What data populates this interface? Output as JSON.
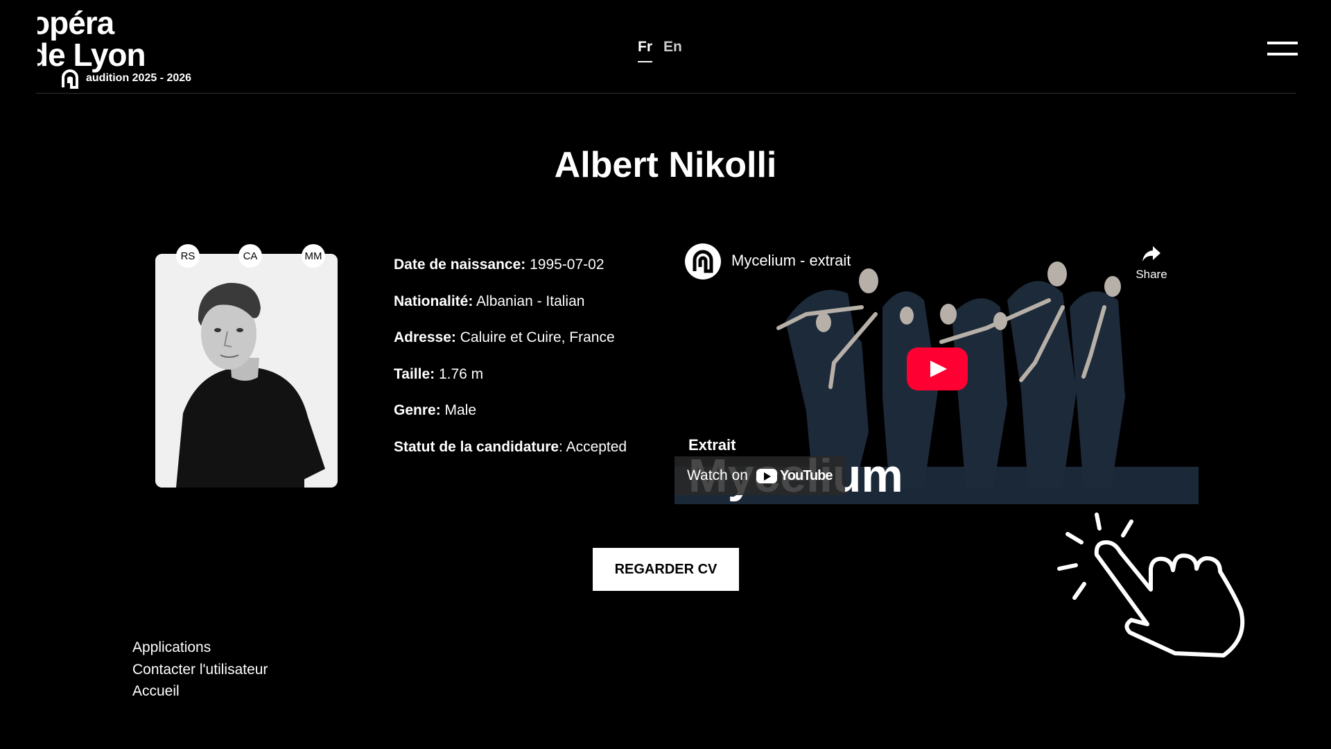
{
  "header": {
    "logo": {
      "line1": "opéra",
      "line2": "de Lyon",
      "subtitle": "audition 2025 - 2026"
    },
    "languages": [
      {
        "label": "Fr",
        "active": true
      },
      {
        "label": "En",
        "active": false
      }
    ],
    "menu_icon": "hamburger-icon"
  },
  "profile": {
    "name": "Albert Nikolli",
    "badges": [
      "RS",
      "CA",
      "MM"
    ],
    "details": [
      {
        "label": "Date de naissance:",
        "value": " 1995-07-02"
      },
      {
        "label": "Nationalité:",
        "value": " Albanian - Italian"
      },
      {
        "label": "Adresse:",
        "value": " Caluire et Cuire, France"
      },
      {
        "label": "Taille:",
        "value": " 1.76 m"
      },
      {
        "label": "Genre:",
        "value": " Male"
      },
      {
        "label": "Statut de la candidature",
        "value": ": Accepted"
      }
    ]
  },
  "video": {
    "title": "Mycelium - extrait",
    "share_label": "Share",
    "overlay_small": "Extrait",
    "overlay_big": "Mycelium",
    "watch_on": "Watch on",
    "youtube_label": "YouTube",
    "play_color": "#ff0033"
  },
  "actions": {
    "cv_button": "REGARDER CV"
  },
  "footer": {
    "links": [
      "Applications",
      "Contacter l'utilisateur",
      "Accueil"
    ]
  }
}
